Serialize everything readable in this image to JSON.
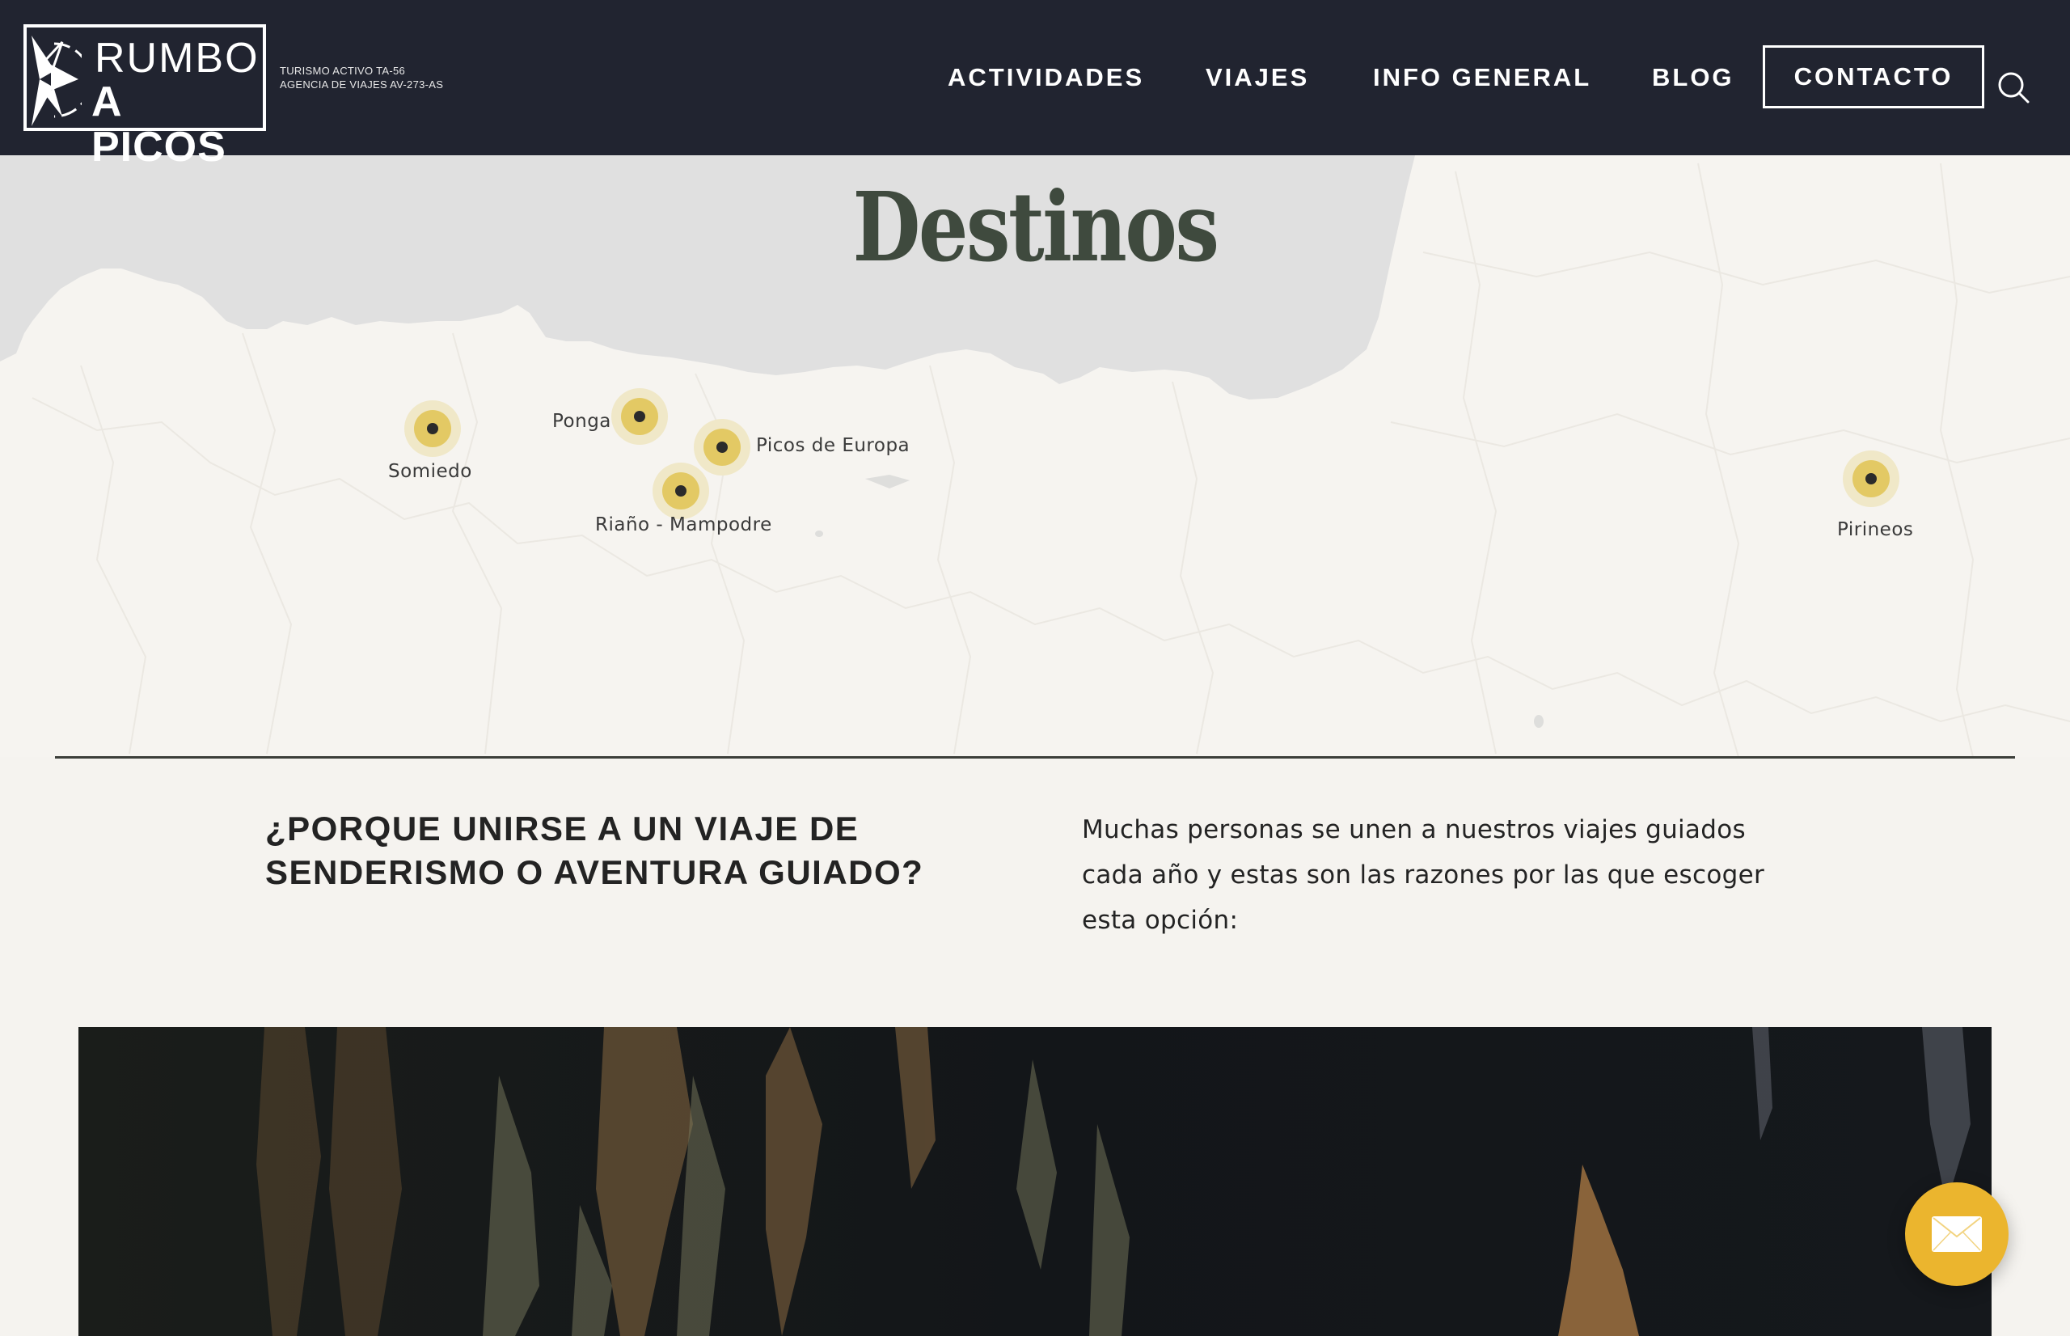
{
  "header": {
    "logo": {
      "line1": "RUMBO",
      "line2": "A PICOS"
    },
    "license": {
      "line1": "TURISMO ACTIVO TA-56",
      "line2": "AGENCIA DE VIAJES AV-273-AS"
    },
    "nav": [
      {
        "label": "ACTIVIDADES"
      },
      {
        "label": "VIAJES"
      },
      {
        "label": "INFO GENERAL"
      },
      {
        "label": "BLOG"
      }
    ],
    "contact_label": "CONTACTO",
    "search_icon": "search-icon"
  },
  "map": {
    "title": "Destinos",
    "destinations": [
      {
        "name": "Somiedo"
      },
      {
        "name": "Ponga"
      },
      {
        "name": "Picos de Europa"
      },
      {
        "name": "Riaño - Mampodre"
      },
      {
        "name": "Pirineos"
      }
    ],
    "colors": {
      "sea": "#e0e0e0",
      "land": "#f6f4f0",
      "marker": "#e3c964",
      "marker_halo": "#f0e8c8",
      "marker_dot": "#2b2b2b"
    }
  },
  "intro": {
    "heading_line1": "¿PORQUE UNIRSE A UN VIAJE DE",
    "heading_line2": "SENDERISMO O AVENTURA GUIADO?",
    "text_line1": "Muchas personas se unen a nuestros viajes guiados",
    "text_line2": "cada año y estas son las razones por las que escoger",
    "text_line3": "esta opción:"
  },
  "fab": {
    "icon": "mail-icon",
    "color": "#ebb52e"
  },
  "theme": {
    "header_bg": "#212430",
    "page_bg": "#f5f3ef",
    "title_color": "#3f4a3e"
  }
}
